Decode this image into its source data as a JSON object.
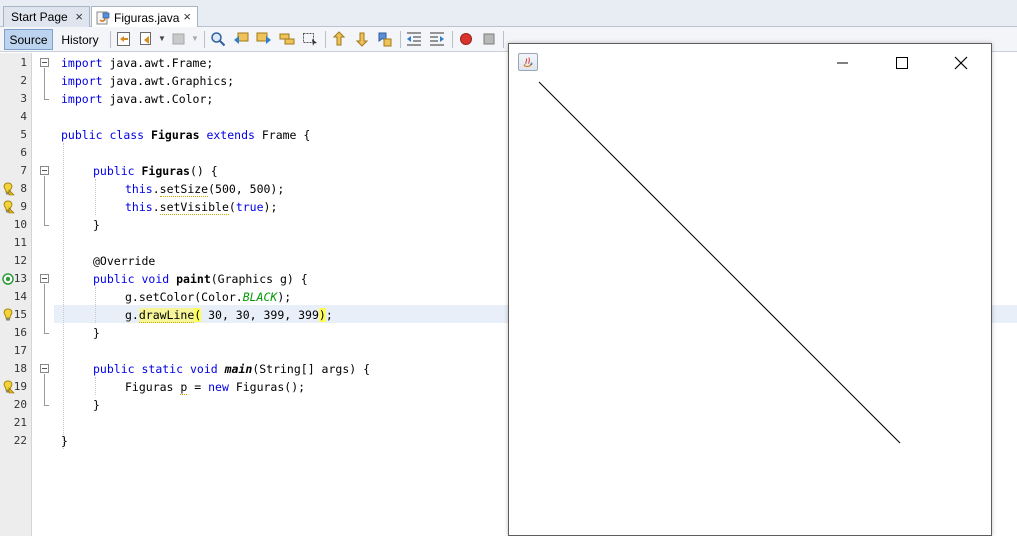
{
  "tabs": [
    {
      "label": "Start Page",
      "active": false,
      "close": "×"
    },
    {
      "label": "Figuras.java",
      "active": true,
      "close": "×"
    }
  ],
  "toolbar": {
    "source_label": "Source",
    "history_label": "History",
    "icons": [
      "last-edit-icon",
      "back-icon",
      "forward-icon",
      "find-icon",
      "find-previous-icon",
      "find-next-icon",
      "find-selection-icon",
      "toggle-highlight-icon",
      "previous-bookmark-icon",
      "next-bookmark-icon",
      "toggle-bookmark-icon",
      "shift-left-icon",
      "shift-right-icon",
      "start-macro-icon",
      "stop-macro-icon",
      "check-icon"
    ]
  },
  "editor": {
    "line_numbers": [
      "1",
      "2",
      "3",
      "4",
      "5",
      "6",
      "7",
      "8",
      "9",
      "10",
      "11",
      "12",
      "13",
      "14",
      "15",
      "16",
      "17",
      "18",
      "19",
      "20",
      "21",
      "22"
    ],
    "lines": {
      "l1": {
        "kw": "import",
        "rest": " java.awt.Frame;"
      },
      "l2": {
        "kw": "import",
        "rest": " java.awt.Graphics;"
      },
      "l3": {
        "kw": "import",
        "rest": " java.awt.Color;"
      },
      "l5": {
        "kw1": "public",
        "kw2": "class",
        "name": "Figuras",
        "kw3": "extends",
        "rest": " Frame {"
      },
      "l7": {
        "kw": "public",
        "name": "Figuras",
        "rest": "() {"
      },
      "l8": {
        "kw": "this",
        "dot": ".",
        "call": "setSize",
        "rest": "(500, 500);"
      },
      "l9": {
        "kw": "this",
        "dot": ".",
        "call": "setVisible",
        "open": "(",
        "kw2": "true",
        "rest": ");"
      },
      "l10": {
        "text": "}"
      },
      "l12": {
        "text": "@Override"
      },
      "l13": {
        "kw1": "public",
        "kw2": "void",
        "name": "paint",
        "rest": "(Graphics g) {"
      },
      "l14": {
        "pre": "g.setColor(Color.",
        "it": "BLACK",
        "rest": ");"
      },
      "l15": {
        "pre": "g.",
        "call": "drawLine",
        "open": "(",
        "args": " 30, 30, 399, 399",
        "close": ")",
        "rest": ";"
      },
      "l16": {
        "text": "}"
      },
      "l18": {
        "kw1": "public",
        "kw2": "static",
        "kw3": "void",
        "name": "main",
        "rest": "(String[] args) {"
      },
      "l19": {
        "pre": "Figuras ",
        "var": "p",
        "eq": " = ",
        "kw": "new",
        "rest": " Figuras();"
      },
      "l20": {
        "text": "}"
      },
      "l22": {
        "text": "}"
      }
    }
  },
  "frame": {
    "controls": {
      "minimize": "—",
      "maximize": "□",
      "close": "×"
    }
  }
}
